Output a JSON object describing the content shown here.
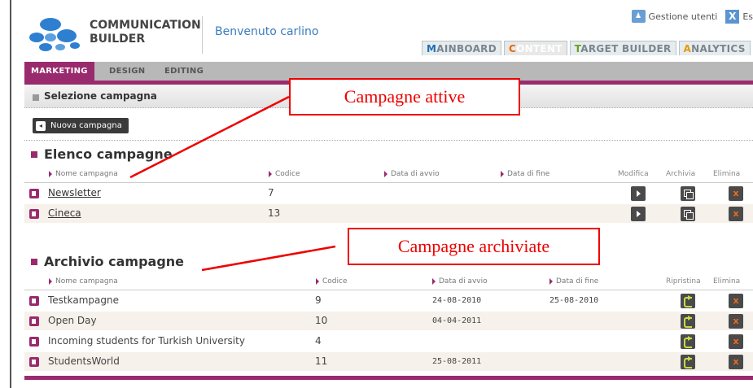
{
  "header": {
    "brand_line1": "COMMUNICATION",
    "brand_line2": "BUILDER",
    "welcome": "Benvenuto carlino",
    "user_management": "Gestione utenti",
    "exit_label": "Es"
  },
  "main_tabs": [
    {
      "first": "M",
      "rest": "AINBOARD"
    },
    {
      "first": "C",
      "rest": "ONTENT"
    },
    {
      "first": "T",
      "rest": "ARGET BUILDER"
    },
    {
      "first": "A",
      "rest": "NALYTICS"
    }
  ],
  "sub_tabs": [
    "MARKETING",
    "DESIGN",
    "EDITING"
  ],
  "section_title": "Selezione campagna",
  "new_campaign_button": "Nuova campagna",
  "active": {
    "heading": "Elenco campagne",
    "columns": [
      "Nome campagna",
      "Codice",
      "Data di avvio",
      "Data di fine",
      "Modifica",
      "Archivia",
      "Elimina"
    ],
    "rows": [
      {
        "name": "Newsletter ",
        "code": "7"
      },
      {
        "name": "Cineca",
        "code": "13"
      }
    ]
  },
  "archive": {
    "heading": "Archivio campagne",
    "columns": [
      "Nome campagna",
      "Codice",
      "Data di avvio",
      "Data di fine",
      "Ripristina",
      "Elimina"
    ],
    "rows": [
      {
        "name": "Testkampagne",
        "code": "9",
        "start": "24-08-2010",
        "end": "25-08-2010"
      },
      {
        "name": "Open Day",
        "code": "10",
        "start": "04-04-2011",
        "end": ""
      },
      {
        "name": "Incoming students for Turkish University",
        "code": "4",
        "start": "",
        "end": ""
      },
      {
        "name": "StudentsWorld",
        "code": "11",
        "start": "25-08-2011",
        "end": ""
      }
    ]
  },
  "annotations": {
    "active_label": "Campagne attive",
    "archived_label": "Campagne archiviate"
  },
  "colors": {
    "accent": "#9a2a6e",
    "link": "#3a7dbf",
    "annotation": "#ee0000"
  }
}
